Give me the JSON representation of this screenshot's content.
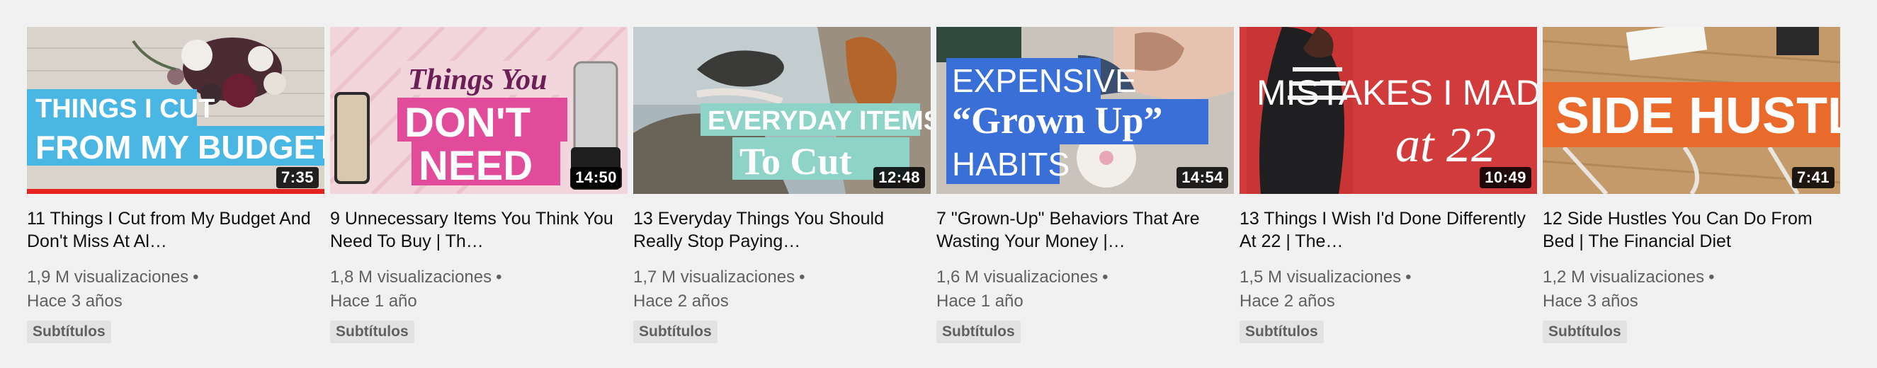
{
  "videos": [
    {
      "title": "11 Things I Cut from My Budget And Don't Miss At Al…",
      "views": "1,9 M visualizaciones",
      "age": "Hace 3 años",
      "badge": "Subtítulos",
      "duration": "7:35",
      "progress_fraction": 1.0,
      "thumb_text": [
        "THINGS I CUT",
        "FROM MY BUDGET"
      ]
    },
    {
      "title": "9 Unnecessary Items You Think You Need To Buy | Th…",
      "views": "1,8 M visualizaciones",
      "age": "Hace 1 año",
      "badge": "Subtítulos",
      "duration": "14:50",
      "thumb_text": [
        "Things You",
        "DON'T",
        "NEED"
      ]
    },
    {
      "title": "13 Everyday Things You Should Really Stop Paying…",
      "views": "1,7 M visualizaciones",
      "age": "Hace 2 años",
      "badge": "Subtítulos",
      "duration": "12:48",
      "thumb_text": [
        "EVERYDAY ITEMS",
        "To Cut"
      ]
    },
    {
      "title": "7 \"Grown-Up\" Behaviors That Are Wasting Your Money |…",
      "views": "1,6 M visualizaciones",
      "age": "Hace 1 año",
      "badge": "Subtítulos",
      "duration": "14:54",
      "thumb_text": [
        "EXPENSIVE",
        "“Grown Up”",
        "HABITS"
      ]
    },
    {
      "title": "13 Things I Wish I'd Done Differently At 22 | The…",
      "views": "1,5 M visualizaciones",
      "age": "Hace 2 años",
      "badge": "Subtítulos",
      "duration": "10:49",
      "thumb_text": [
        "MISTAKES I MADE",
        "at 22"
      ]
    },
    {
      "title": "12 Side Hustles You Can Do From Bed | The Financial Diet",
      "views": "1,2 M visualizaciones",
      "age": "Hace 3 años",
      "badge": "Subtítulos",
      "duration": "7:41",
      "thumb_text": [
        "SIDE HUSTLES"
      ]
    }
  ],
  "colors": {
    "background": "#f1f1f1",
    "progress_red": "#e4231f",
    "meta_gray": "#606060",
    "badge_bg": "#e2e2e2"
  }
}
